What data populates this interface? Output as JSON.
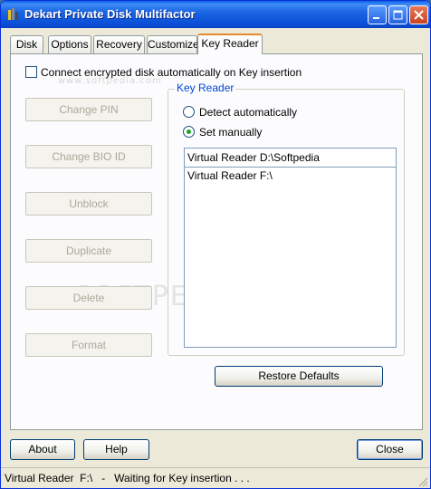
{
  "window": {
    "title": "Dekart Private Disk Multifactor"
  },
  "tabs": [
    {
      "label": "Disk"
    },
    {
      "label": "Options"
    },
    {
      "label": "Recovery"
    },
    {
      "label": "Customize"
    },
    {
      "label": "Key Reader"
    }
  ],
  "panel": {
    "auto_connect_label": "Connect encrypted disk automatically on Key insertion",
    "watermark": "www.softpedia.com",
    "watermark_big": "SOFTPEDIA",
    "buttons": {
      "change_pin": "Change PIN",
      "change_bio": "Change BIO ID",
      "unblock": "Unblock",
      "duplicate": "Duplicate",
      "delete": "Delete",
      "format": "Format"
    },
    "key_reader": {
      "legend": "Key Reader",
      "detect_auto": "Detect automatically",
      "set_manually": "Set manually",
      "selected": "Virtual Reader  D:\\Softpedia",
      "list": [
        "Virtual Reader  F:\\"
      ],
      "restore_defaults": "Restore Defaults"
    }
  },
  "footer": {
    "about": "About",
    "help": "Help",
    "close": "Close"
  },
  "status": {
    "text": "Virtual Reader  F:\\   -   Waiting for Key insertion . . ."
  }
}
